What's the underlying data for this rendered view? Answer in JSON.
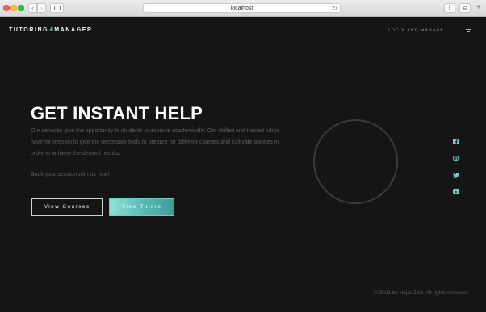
{
  "browser": {
    "url": "localhost",
    "back_glyph": "‹",
    "forward_glyph": "›",
    "reload_glyph": "↻",
    "share_glyph": "⇪",
    "tabs_glyph": "⧉",
    "newtab_glyph": "+"
  },
  "nav": {
    "logo_left": "TUTORING",
    "logo_mark": "&",
    "logo_right": "MANAGER",
    "login_label": "LOGIN AND MANAGE",
    "menu_icon": "menu-icon"
  },
  "hero": {
    "title": "GET INSTANT HELP",
    "description": "Our services give the opportunity to students to improve academically. Our skilled and trained tutors have for mission to give the necessary tools to prepare for different courses and cultivate abilities in order to achieve the desired results.",
    "cta_text": "Book your session with us now!",
    "courses_button": "View Courses",
    "tutors_button": "View Tutors"
  },
  "social": {
    "icons": [
      "facebook-icon",
      "instagram-icon",
      "twitter-icon",
      "youtube-icon"
    ],
    "color": "#6fd0c8"
  },
  "footer": {
    "copyright": "© 2021 by Hajar Zaiz. All rights reserved."
  },
  "colors": {
    "background": "#151515",
    "accent": "#6fd0c8"
  }
}
